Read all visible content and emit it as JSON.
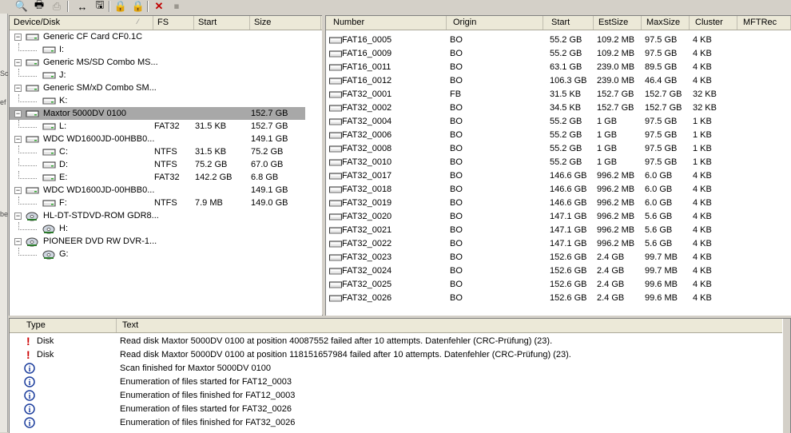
{
  "toolbar": {
    "buttons": [
      {
        "name": "search-icon",
        "glyph": "🔍"
      },
      {
        "name": "print-preview-icon",
        "glyph": "🖶"
      },
      {
        "name": "print-icon",
        "glyph": "⎙"
      },
      {
        "name": "resize-icon",
        "glyph": "↔"
      },
      {
        "name": "save-disk-icon",
        "glyph": "🖫"
      },
      {
        "name": "lock-icon",
        "glyph": "🔒"
      },
      {
        "name": "lock2-icon",
        "glyph": "🔒"
      },
      {
        "name": "delete-icon",
        "glyph": "✕"
      },
      {
        "name": "stop-icon",
        "glyph": "⏹"
      }
    ]
  },
  "tree": {
    "columns": [
      "Device/Disk",
      "FS",
      "Start",
      "Size"
    ],
    "rows": [
      {
        "level": 0,
        "label": "Generic CF Card CF0.1C",
        "fs": "",
        "start": "",
        "size": ""
      },
      {
        "level": 1,
        "label": "I:",
        "fs": "",
        "start": "",
        "size": ""
      },
      {
        "level": 0,
        "label": "Generic MS/SD Combo MS...",
        "fs": "",
        "start": "",
        "size": ""
      },
      {
        "level": 1,
        "label": "J:",
        "fs": "",
        "start": "",
        "size": ""
      },
      {
        "level": 0,
        "label": "Generic SM/xD Combo SM...",
        "fs": "",
        "start": "",
        "size": ""
      },
      {
        "level": 1,
        "label": "K:",
        "fs": "",
        "start": "",
        "size": ""
      },
      {
        "level": 0,
        "label": "Maxtor 5000DV 0100",
        "fs": "",
        "start": "",
        "size": "152.7 GB",
        "selected": true
      },
      {
        "level": 1,
        "label": "L:",
        "fs": "FAT32",
        "start": "31.5 KB",
        "size": "152.7 GB"
      },
      {
        "level": 0,
        "label": "WDC WD1600JD-00HBB0...",
        "fs": "",
        "start": "",
        "size": "149.1 GB"
      },
      {
        "level": 1,
        "label": "C:",
        "fs": "NTFS",
        "start": "31.5 KB",
        "size": "75.2 GB"
      },
      {
        "level": 1,
        "label": "D:",
        "fs": "NTFS",
        "start": "75.2 GB",
        "size": "67.0 GB"
      },
      {
        "level": 1,
        "label": "E:",
        "fs": "FAT32",
        "start": "142.2 GB",
        "size": "6.8 GB"
      },
      {
        "level": 0,
        "label": "WDC WD1600JD-00HBB0...",
        "fs": "",
        "start": "",
        "size": "149.1 GB"
      },
      {
        "level": 1,
        "label": "F:",
        "fs": "NTFS",
        "start": "7.9 MB",
        "size": "149.0 GB"
      },
      {
        "level": 0,
        "label": "HL-DT-STDVD-ROM GDR8...",
        "fs": "",
        "start": "",
        "size": "",
        "optical": true
      },
      {
        "level": 1,
        "label": "H:",
        "fs": "",
        "start": "",
        "size": "",
        "optical": true
      },
      {
        "level": 0,
        "label": "PIONEER DVD RW DVR-1...",
        "fs": "",
        "start": "",
        "size": "",
        "optical": true
      },
      {
        "level": 1,
        "label": "G:",
        "fs": "",
        "start": "",
        "size": "",
        "optical": true
      }
    ]
  },
  "list": {
    "columns": [
      "Number",
      "Origin",
      "Start",
      "EstSize",
      "MaxSize",
      "Cluster",
      "MFTRec"
    ],
    "rows": [
      [
        "FAT16_0005",
        "BO",
        "55.2 GB",
        "109.2 MB",
        "97.5 GB",
        "4 KB",
        ""
      ],
      [
        "FAT16_0009",
        "BO",
        "55.2 GB",
        "109.2 MB",
        "97.5 GB",
        "4 KB",
        ""
      ],
      [
        "FAT16_0011",
        "BO",
        "63.1 GB",
        "239.0 MB",
        "89.5 GB",
        "4 KB",
        ""
      ],
      [
        "FAT16_0012",
        "BO",
        "106.3 GB",
        "239.0 MB",
        "46.4 GB",
        "4 KB",
        ""
      ],
      [
        "FAT32_0001",
        "FB",
        "31.5 KB",
        "152.7 GB",
        "152.7 GB",
        "32 KB",
        ""
      ],
      [
        "FAT32_0002",
        "BO",
        "34.5 KB",
        "152.7 GB",
        "152.7 GB",
        "32 KB",
        ""
      ],
      [
        "FAT32_0004",
        "BO",
        "55.2 GB",
        "1 GB",
        "97.5 GB",
        "1 KB",
        ""
      ],
      [
        "FAT32_0006",
        "BO",
        "55.2 GB",
        "1 GB",
        "97.5 GB",
        "1 KB",
        ""
      ],
      [
        "FAT32_0008",
        "BO",
        "55.2 GB",
        "1 GB",
        "97.5 GB",
        "1 KB",
        ""
      ],
      [
        "FAT32_0010",
        "BO",
        "55.2 GB",
        "1 GB",
        "97.5 GB",
        "1 KB",
        ""
      ],
      [
        "FAT32_0017",
        "BO",
        "146.6 GB",
        "996.2 MB",
        "6.0 GB",
        "4 KB",
        ""
      ],
      [
        "FAT32_0018",
        "BO",
        "146.6 GB",
        "996.2 MB",
        "6.0 GB",
        "4 KB",
        ""
      ],
      [
        "FAT32_0019",
        "BO",
        "146.6 GB",
        "996.2 MB",
        "6.0 GB",
        "4 KB",
        ""
      ],
      [
        "FAT32_0020",
        "BO",
        "147.1 GB",
        "996.2 MB",
        "5.6 GB",
        "4 KB",
        ""
      ],
      [
        "FAT32_0021",
        "BO",
        "147.1 GB",
        "996.2 MB",
        "5.6 GB",
        "4 KB",
        ""
      ],
      [
        "FAT32_0022",
        "BO",
        "147.1 GB",
        "996.2 MB",
        "5.6 GB",
        "4 KB",
        ""
      ],
      [
        "FAT32_0023",
        "BO",
        "152.6 GB",
        "2.4 GB",
        "99.7 MB",
        "4 KB",
        ""
      ],
      [
        "FAT32_0024",
        "BO",
        "152.6 GB",
        "2.4 GB",
        "99.7 MB",
        "4 KB",
        ""
      ],
      [
        "FAT32_0025",
        "BO",
        "152.6 GB",
        "2.4 GB",
        "99.6 MB",
        "4 KB",
        ""
      ],
      [
        "FAT32_0026",
        "BO",
        "152.6 GB",
        "2.4 GB",
        "99.6 MB",
        "4 KB",
        ""
      ]
    ]
  },
  "log": {
    "columns": [
      "Type",
      "Text"
    ],
    "rows": [
      {
        "kind": "error",
        "type": "Disk",
        "text": "Read disk Maxtor 5000DV 0100 at position 40087552 failed after 10 attempts. Datenfehler (CRC-Prüfung) (23)."
      },
      {
        "kind": "error",
        "type": "Disk",
        "text": "Read disk Maxtor 5000DV 0100 at position 118151657984 failed after 10 attempts. Datenfehler (CRC-Prüfung) (23)."
      },
      {
        "kind": "info",
        "type": "",
        "text": "Scan finished for Maxtor 5000DV 0100"
      },
      {
        "kind": "info",
        "type": "",
        "text": "Enumeration of files started for FAT12_0003"
      },
      {
        "kind": "info",
        "type": "",
        "text": "Enumeration of files finished for FAT12_0003"
      },
      {
        "kind": "info",
        "type": "",
        "text": "Enumeration of files started for FAT32_0026"
      },
      {
        "kind": "info",
        "type": "",
        "text": "Enumeration of files finished for FAT32_0026"
      }
    ]
  },
  "leftstrip": [
    "Sc",
    "ef",
    "be"
  ],
  "colors": {
    "selection": "#a8a8a8",
    "error": "#cc0000",
    "info": "#1a3c9c",
    "header": "#ece9d8"
  }
}
